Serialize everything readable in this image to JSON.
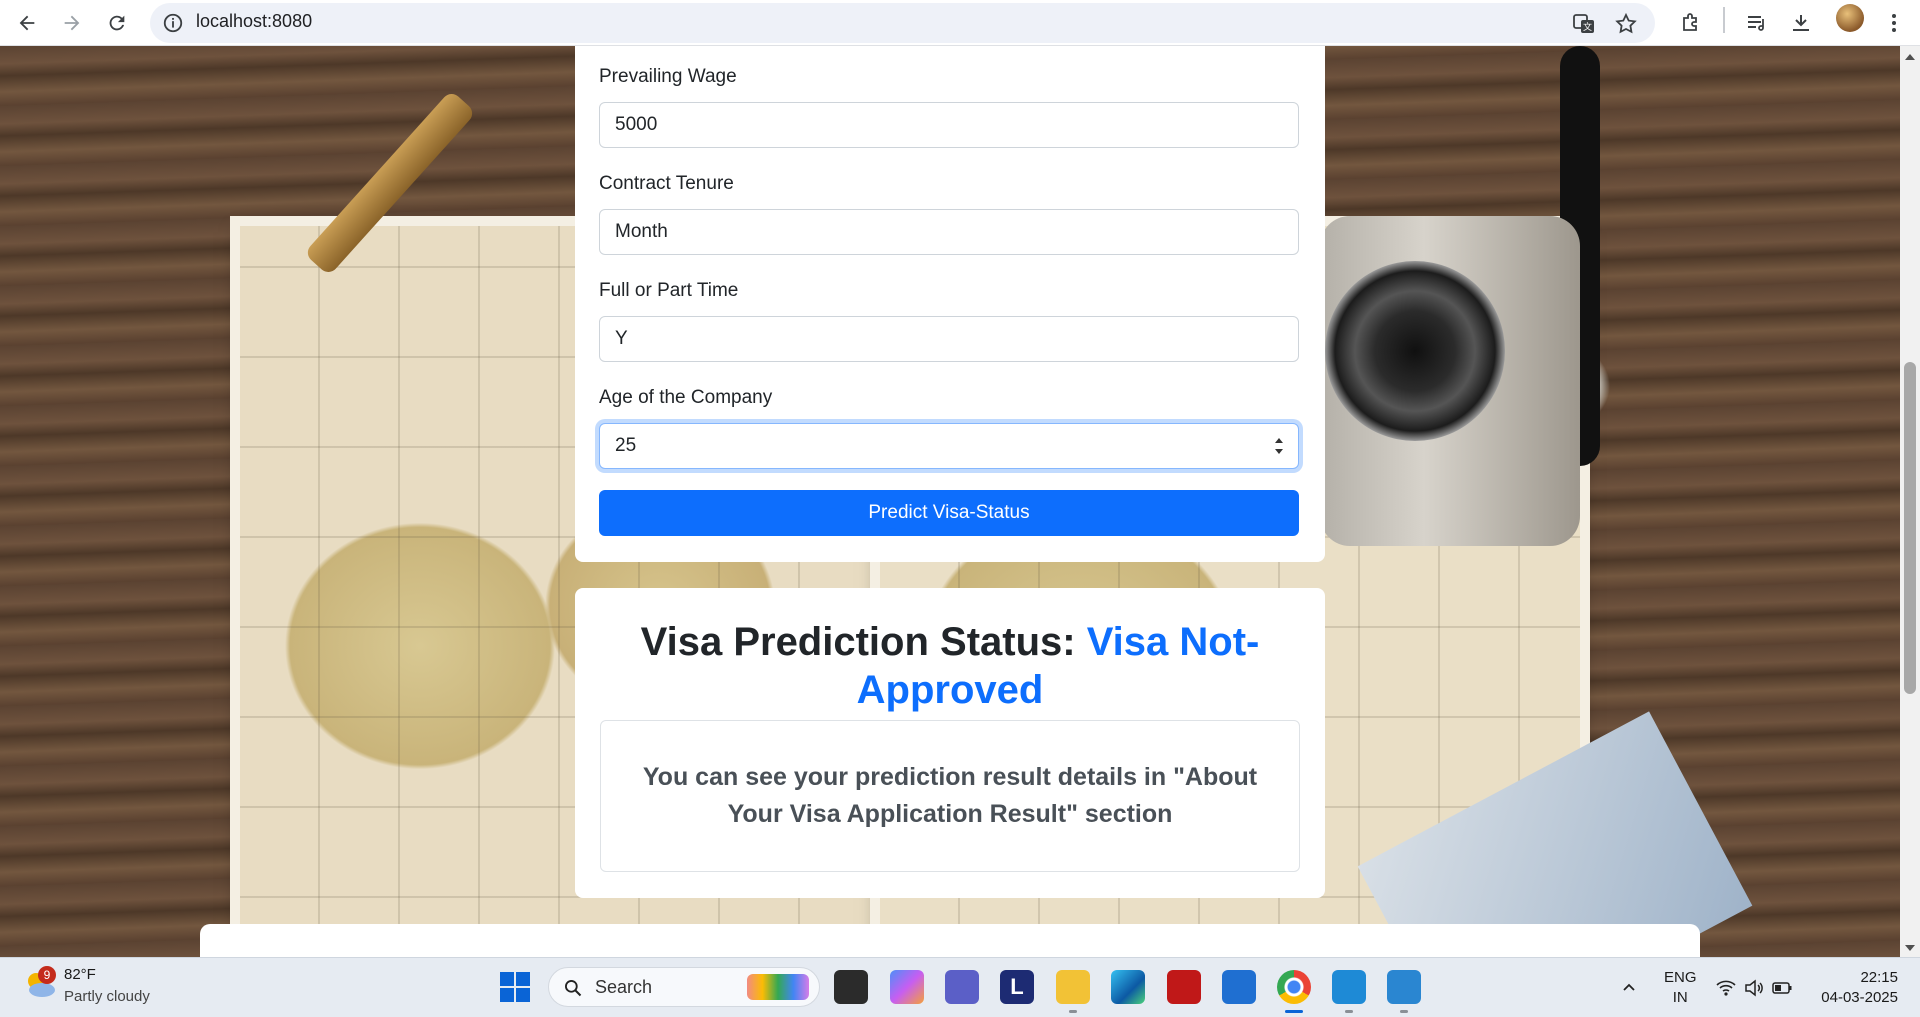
{
  "browser": {
    "url": "localhost:8080"
  },
  "form": {
    "fields": [
      {
        "label": "Prevailing Wage",
        "value": "5000"
      },
      {
        "label": "Contract Tenure",
        "value": "Month"
      },
      {
        "label": "Full or Part Time",
        "value": "Y"
      },
      {
        "label": "Age of the Company",
        "value": "25"
      }
    ],
    "submit_label": "Predict Visa-Status"
  },
  "result": {
    "title_prefix": "Visa Prediction Status: ",
    "status": "Visa Not-Approved",
    "status_color": "#0d6efd",
    "details": "You can see your prediction result details in \"About Your Visa Application Result\" section"
  },
  "taskbar": {
    "weather": {
      "badge": "9",
      "temp": "82°F",
      "desc": "Partly cloudy"
    },
    "search_label": "Search",
    "apps": [
      "file-explorer-icon",
      "copilot-icon",
      "teams-icon",
      "l-app-icon",
      "folder-icon",
      "edge-icon",
      "mcafee-icon",
      "store-icon",
      "chrome-icon",
      "vscode-icon",
      "monitor-icon"
    ],
    "lang": {
      "line1": "ENG",
      "line2": "IN"
    },
    "clock": {
      "time": "22:15",
      "date": "04-03-2025"
    }
  },
  "colors": {
    "accent": "#0d6efd",
    "taskbar_bg": "#e6ebf2"
  }
}
